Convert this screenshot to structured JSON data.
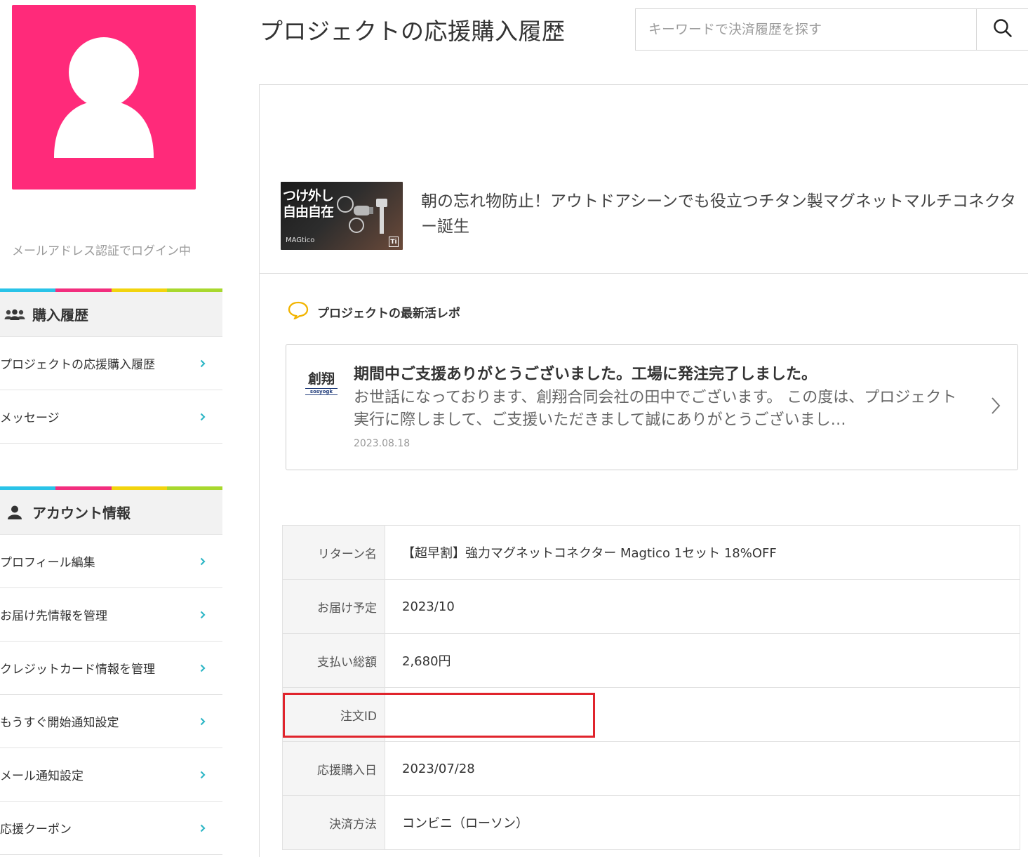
{
  "sidebar": {
    "login_status": "メールアドレス認証でログイン中",
    "avatar_color": "#ff2a7a",
    "stripe_colors": [
      "#29c3e8",
      "#f22e7e",
      "#f2d40e",
      "#a8d82e"
    ],
    "purchase_section": {
      "title": "購入履歴",
      "icon": "group-icon",
      "items": [
        {
          "label": "プロジェクトの応援購入履歴"
        },
        {
          "label": "メッセージ"
        }
      ]
    },
    "account_section": {
      "title": "アカウント情報",
      "icon": "person-icon",
      "items": [
        {
          "label": "プロフィール編集"
        },
        {
          "label": "お届け先情報を管理"
        },
        {
          "label": "クレジットカード情報を管理"
        },
        {
          "label": "もうすぐ開始通知設定"
        },
        {
          "label": "メール通知設定"
        },
        {
          "label": "応援クーポン"
        }
      ]
    }
  },
  "header": {
    "title": "プロジェクトの応援購入履歴",
    "search_placeholder": "キーワードで決済履歴を探す",
    "search_icon": "search-icon"
  },
  "project": {
    "thumb_line1": "つけ外し",
    "thumb_line2": "自由自在",
    "thumb_brand": "MAGtico",
    "thumb_badge": "Ti",
    "name": "朝の忘れ物防止！アウトドアシーンでも役立つチタン製マグネットマルチコネクター誕生"
  },
  "report": {
    "section_title": "プロジェクトの最新活レポ",
    "logo_text": "創翔",
    "logo_sub": "sosyogk",
    "heading": "期間中ご支援ありがとうございました。工場に発注完了しました。",
    "body": "お世話になっております、創翔合同会社の田中でございます。 この度は、プロジェクト実行に際しまして、ご支援いただきまして誠にありがとうございまし…",
    "date": "2023.08.18"
  },
  "details": [
    {
      "label": "リターン名",
      "value": "【超早割】強力マグネットコネクター Magtico 1セット 18%OFF"
    },
    {
      "label": "お届け予定",
      "value": "2023/10"
    },
    {
      "label": "支払い総額",
      "value": "2,680円"
    },
    {
      "label": "注文ID",
      "value": ""
    },
    {
      "label": "応援購入日",
      "value": "2023/07/28"
    },
    {
      "label": "決済方法",
      "value": "コンビニ（ローソン）"
    }
  ],
  "accent_colors": {
    "chevron": "#2fb7c6",
    "highlight": "#e0242c",
    "speech_icon": "#f2b400"
  }
}
